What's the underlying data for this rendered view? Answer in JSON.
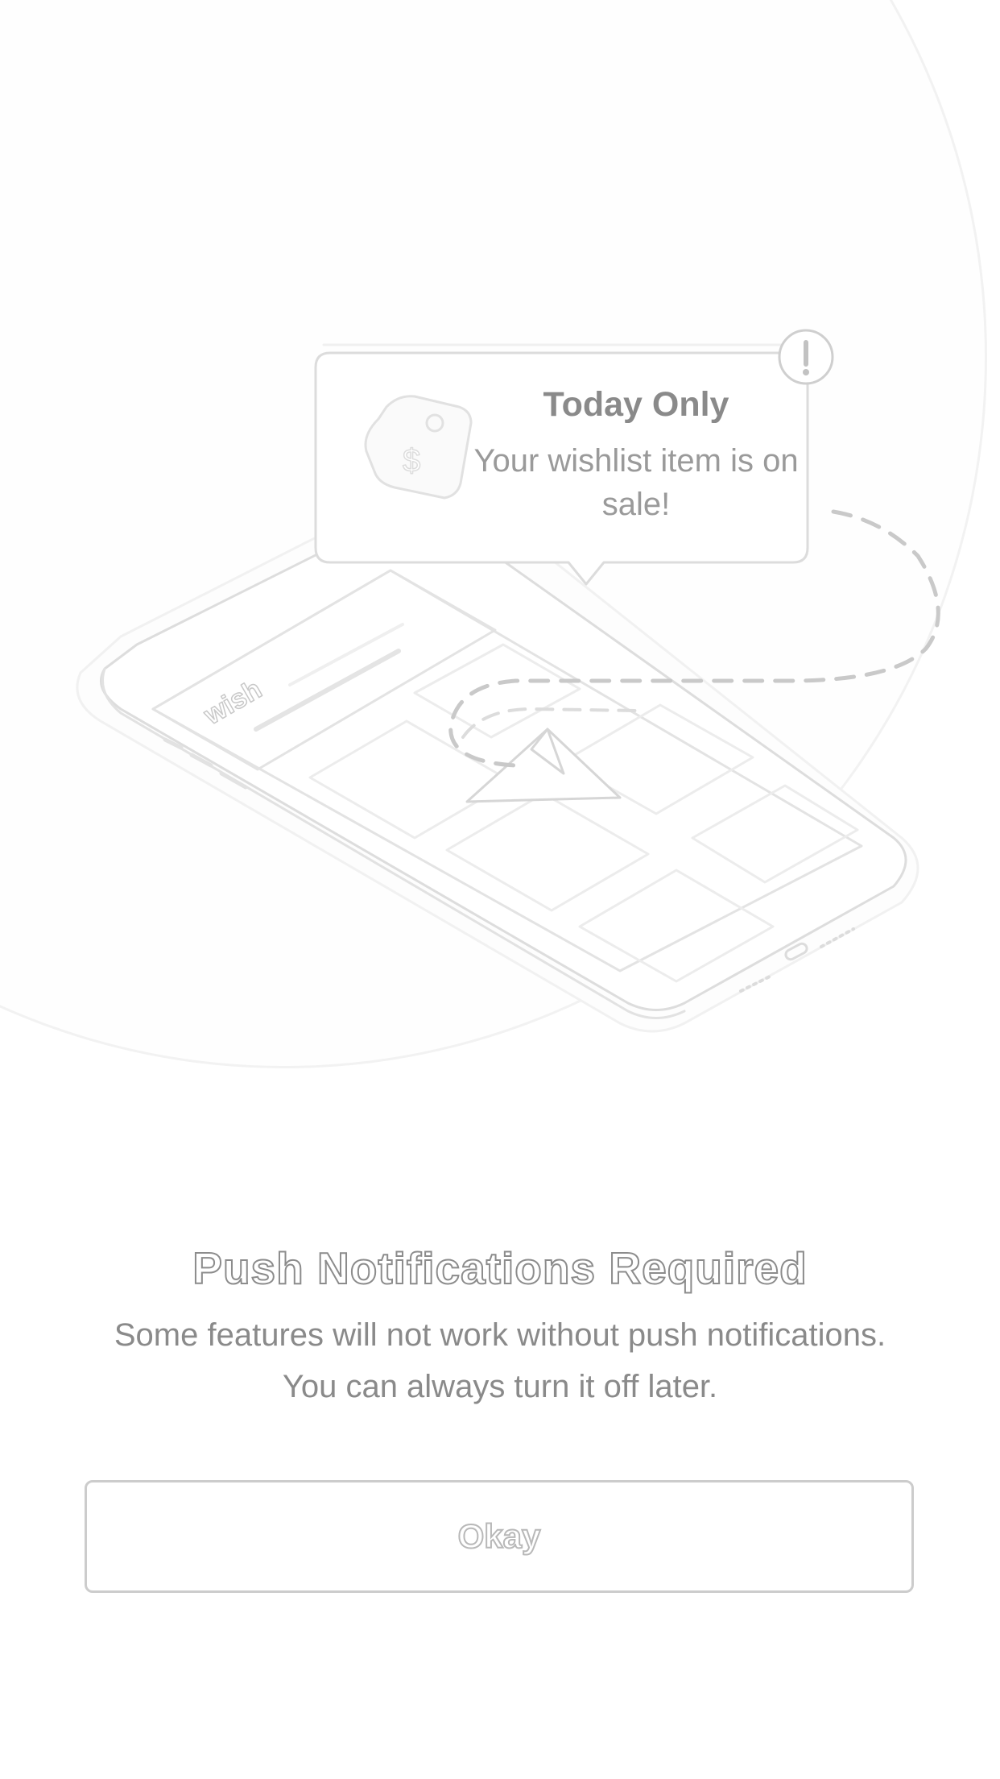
{
  "notification_card": {
    "title": "Today Only",
    "body": "Your wishlist item is on sale!",
    "app_logo_text": "wish",
    "alert_icon": "exclamation-icon",
    "tag_icon": "price-tag-icon"
  },
  "permission_prompt": {
    "heading": "Push Notifications Required",
    "line1": "Some features will not work without push notifications.",
    "line2": "You can always turn it off later.",
    "button_label": "Okay"
  },
  "colors": {
    "background": "#ffffff",
    "outline": "#dcdcdc",
    "text": "#8a8a8a"
  }
}
